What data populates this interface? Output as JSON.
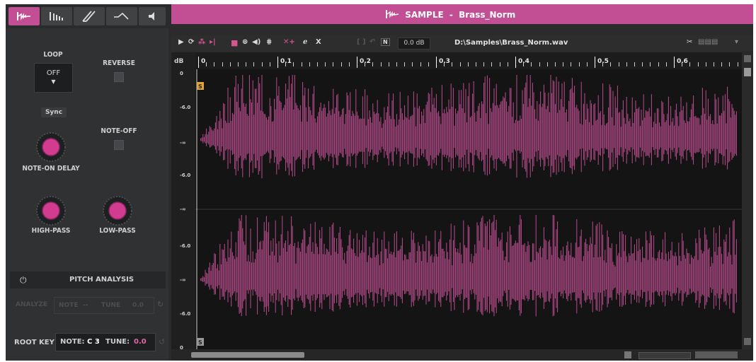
{
  "tabs": [
    {
      "name": "sample-tab",
      "icon": "sample-waveform-icon"
    },
    {
      "name": "slices-tab",
      "icon": "slices-icon"
    },
    {
      "name": "pitch-tab",
      "icon": "pitch-icon"
    },
    {
      "name": "envelope-tab",
      "icon": "envelope-icon"
    },
    {
      "name": "speaker-tab",
      "icon": "speaker-icon"
    }
  ],
  "left": {
    "loop_label": "LOOP",
    "loop_value": "OFF",
    "reverse_label": "REVERSE",
    "sync_label": "Sync",
    "note_off_label": "NOTE-OFF",
    "note_on_delay_label": "NOTE-ON DELAY",
    "high_pass_label": "HIGH-PASS",
    "low_pass_label": "LOW-PASS",
    "pitch_analysis_title": "PITCH ANALYSIS",
    "analysis_row": {
      "label": "ANALYZE",
      "note": "NOTE",
      "dash": "--",
      "tune": "TUNE",
      "value": "0.0"
    },
    "root_key": {
      "label": "ROOT KEY",
      "note_label": "NOTE:",
      "note_value": "C 3",
      "tune_label": "TUNE:",
      "tune_value": "0.0"
    }
  },
  "sample": {
    "header_label": "SAMPLE",
    "separator": "-",
    "name": "Brass_Norm",
    "volume": "0.0 dB",
    "path": "D:\\Samples\\Brass_Norm.wav",
    "toolbar_x": "X",
    "toolbar_n": "N"
  },
  "waveform": {
    "db_unit": "dB",
    "db_labels": [
      "0",
      "-6.0",
      "-∞",
      "-6.0",
      "-∞",
      "-6.0",
      "-∞",
      "-6.0",
      "0"
    ],
    "time_labels": [
      "0",
      "0.1",
      "0.2",
      "0.3",
      "0.4",
      "0.5",
      "0.6"
    ],
    "marker_start": "S",
    "marker_end": "S",
    "colors": {
      "accent": "#c24f93",
      "wave": "#c24f93",
      "background": "#141414"
    }
  }
}
